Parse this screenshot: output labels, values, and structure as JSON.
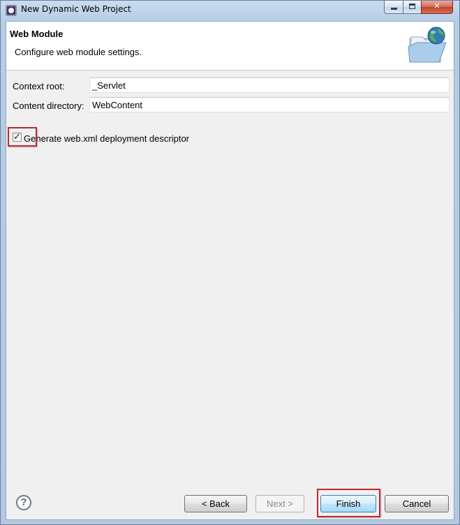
{
  "window": {
    "title": "New Dynamic Web Project",
    "controls": {
      "minimize": "minimize",
      "maximize": "maximize",
      "close": "✕"
    }
  },
  "header": {
    "title": "Web Module",
    "description": "Configure web module settings.",
    "icon": "web-folder-globe-icon"
  },
  "form": {
    "context_root": {
      "label": "Context root:",
      "value": "_Servlet"
    },
    "content_directory": {
      "label": "Content directory:",
      "value": "WebContent"
    },
    "generate_descriptor": {
      "label": "Generate web.xml deployment descriptor",
      "checked": true
    }
  },
  "footer": {
    "help": "?",
    "back": "< Back",
    "next": "Next >",
    "finish": "Finish",
    "cancel": "Cancel"
  },
  "colors": {
    "highlight": "#c0282f",
    "default_button": "#bee6fd",
    "client_bg": "#f0f0f0"
  }
}
